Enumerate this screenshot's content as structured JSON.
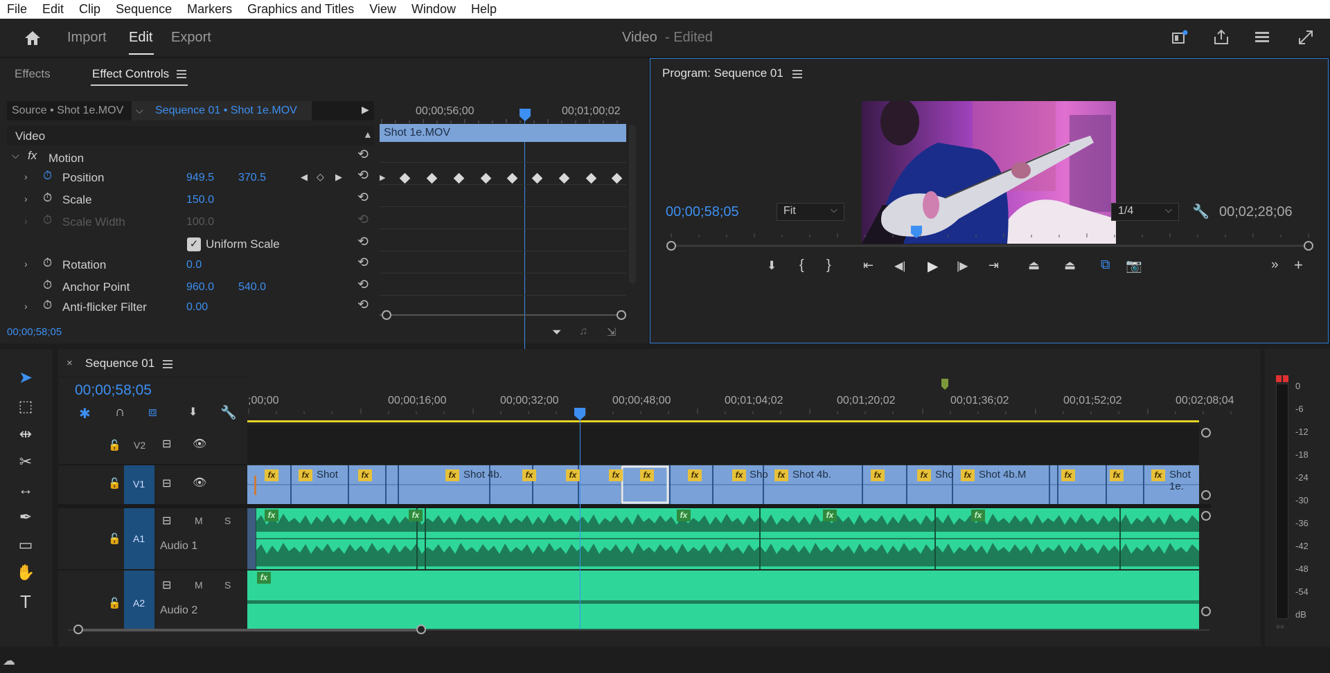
{
  "menu": [
    "File",
    "Edit",
    "Clip",
    "Sequence",
    "Markers",
    "Graphics and Titles",
    "View",
    "Window",
    "Help"
  ],
  "header": {
    "import": "Import",
    "edit": "Edit",
    "export": "Export",
    "title": "Video",
    "status": "- Edited"
  },
  "effect_controls": {
    "tabs": [
      "Effects",
      "Effect Controls"
    ],
    "source": "Source • Shot 1e.MOV",
    "sequence": "Sequence 01 • Shot 1e.MOV",
    "ruler": [
      "00;00;56;00",
      "00;01;00;02"
    ],
    "clip": "Shot 1e.MOV",
    "section": "Video",
    "motion": "Motion",
    "fx": "fx",
    "rows": [
      {
        "name": "Position",
        "v1": "949.5",
        "v2": "370.5"
      },
      {
        "name": "Scale",
        "v1": "150.0"
      },
      {
        "name": "Scale Width",
        "v1": "100.0"
      },
      {
        "name": "Uniform Scale"
      },
      {
        "name": "Rotation",
        "v1": "0.0"
      },
      {
        "name": "Anchor Point",
        "v1": "960.0",
        "v2": "540.0"
      },
      {
        "name": "Anti-flicker Filter",
        "v1": "0.00"
      }
    ],
    "timecode": "00;00;58;05"
  },
  "program": {
    "title": "Program: Sequence 01",
    "timecode": "00;00;58;05",
    "fit": "Fit",
    "quality": "1/4",
    "duration": "00;02;28;06",
    "playhead_fraction": 0.385
  },
  "sequence": {
    "title": "Sequence 01",
    "timecode": "00;00;58;05",
    "ruler": [
      ";00;00",
      "00;00;16;00",
      "00;00;32;00",
      "00;00;48;00",
      "00;01;04;02",
      "00;01;20;02",
      "00;01;36;02",
      "00;01;52;02",
      "00;02;08;04"
    ],
    "tracks": {
      "v2": "V2",
      "v1": "V1",
      "a1": "A1",
      "a2": "A2",
      "audio1": "Audio 1",
      "audio2": "Audio 2",
      "m": "M",
      "s": "S"
    },
    "clip_labels": [
      "Shot",
      "Shot 4b.",
      "Sho",
      "Shot 4b.",
      "Sho",
      "Shot 4b.M",
      "Shot 1e."
    ],
    "fx": "fx"
  },
  "meter": {
    "labels": [
      "0",
      "-6",
      "-12",
      "-18",
      "-24",
      "-30",
      "-36",
      "-42",
      "-48",
      "-54",
      "dB"
    ]
  }
}
